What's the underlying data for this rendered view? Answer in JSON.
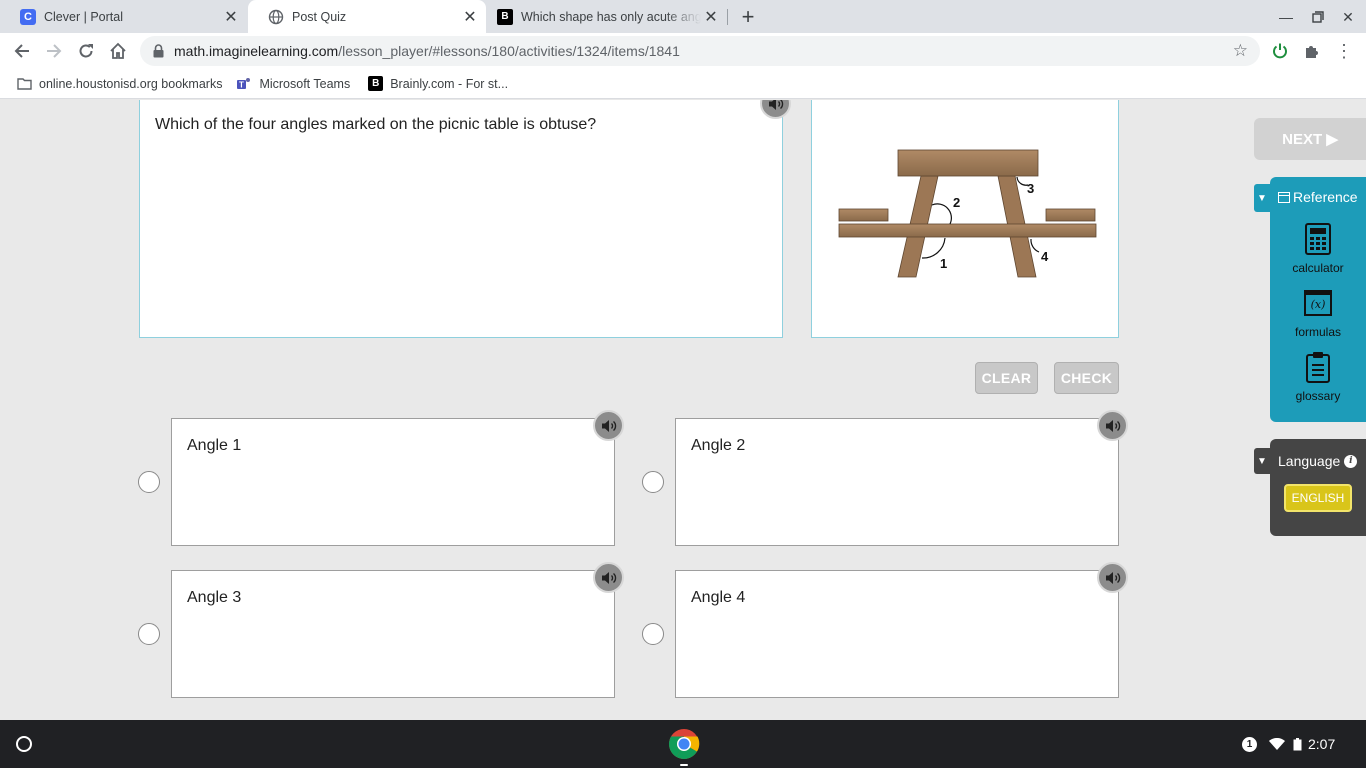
{
  "browser": {
    "tabs": [
      {
        "title": "Clever | Portal",
        "favicon": "clever-icon",
        "favicon_text": "C"
      },
      {
        "title": "Post Quiz",
        "favicon": "globe-icon"
      },
      {
        "title": "Which shape has only acute angles",
        "favicon": "brainly-icon",
        "favicon_text": "B"
      }
    ],
    "url_domain": "math.imaginelearning.com",
    "url_path": "/lesson_player/#lessons/180/activities/1324/items/1841"
  },
  "bookmarks": [
    {
      "label": "online.houstonisd.org bookmarks",
      "icon": "folder-icon"
    },
    {
      "label": "Microsoft Teams",
      "icon": "teams-icon"
    },
    {
      "label": "Brainly.com - For st...",
      "icon": "brainly-icon",
      "icon_text": "B"
    }
  ],
  "question": {
    "text": "Which of the four angles marked on the picnic table is obtuse?",
    "figure_labels": [
      "1",
      "2",
      "3",
      "4"
    ]
  },
  "actions": {
    "clear": "CLEAR",
    "check": "CHECK",
    "next": "NEXT ▶"
  },
  "choices": [
    {
      "label": "Angle 1"
    },
    {
      "label": "Angle 2"
    },
    {
      "label": "Angle 3"
    },
    {
      "label": "Angle 4"
    }
  ],
  "reference": {
    "title": "Reference",
    "tools": [
      {
        "label": "calculator",
        "icon": "calculator-icon"
      },
      {
        "label": "formulas",
        "icon": "formulas-icon",
        "icon_text": "(x)"
      },
      {
        "label": "glossary",
        "icon": "glossary-icon"
      }
    ]
  },
  "language": {
    "title": "Language",
    "selected": "ENGLISH",
    "info": "i"
  },
  "system": {
    "notification_count": "1",
    "time": "2:07"
  },
  "colors": {
    "panel_teal": "#1d9cb9",
    "language_dark": "#454545",
    "english_yellow": "#d9c51a",
    "box_border": "#8fd0de",
    "table_wood": "#a07c58"
  }
}
